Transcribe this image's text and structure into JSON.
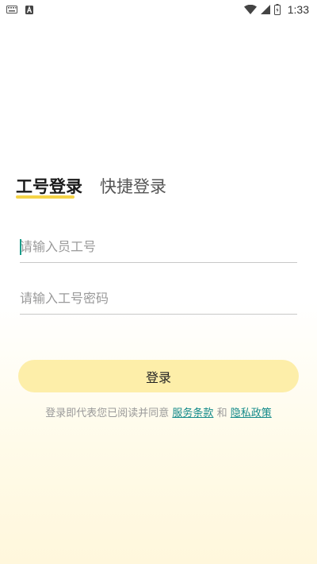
{
  "status_bar": {
    "time": "1:33",
    "icons": [
      "keyboard-icon",
      "font-a-icon",
      "wifi-icon",
      "cellular-signal-icon",
      "battery-icon"
    ]
  },
  "tabs": [
    {
      "label": "工号登录",
      "active": true
    },
    {
      "label": "快捷登录",
      "active": false
    }
  ],
  "form": {
    "employee_id_placeholder": "请输入员工号",
    "password_placeholder": "请输入工号密码",
    "employee_id_value": "",
    "password_value": ""
  },
  "login_button": {
    "label": "登录"
  },
  "agreement": {
    "prefix": "登录即代表您已阅读并同意",
    "terms_link": "服务条款",
    "conjunction": "和",
    "privacy_link": "隐私政策"
  },
  "colors": {
    "accent_yellow": "#f5d347",
    "button_bg": "#fdeea9",
    "link": "#138a8a",
    "cursor": "#1a9c8a"
  }
}
